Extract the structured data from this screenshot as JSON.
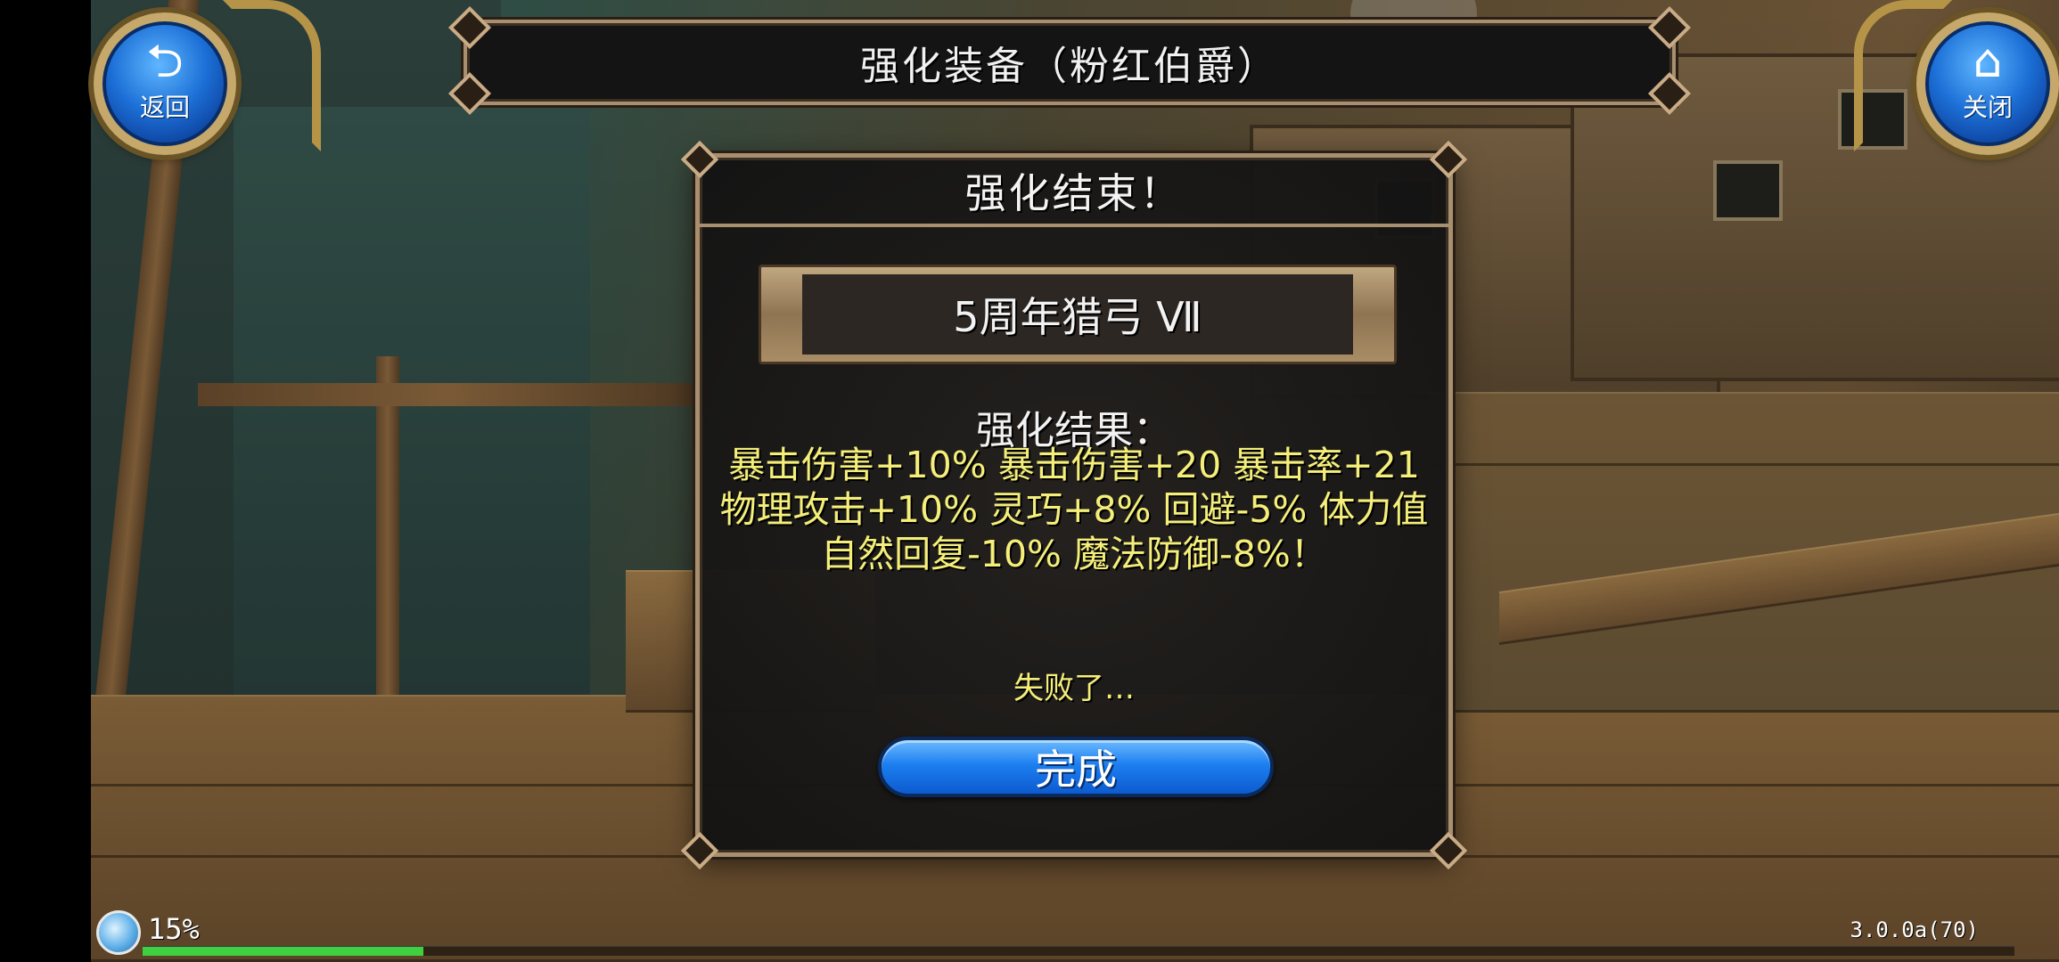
{
  "top_bar": {
    "title": "强化装备（粉红伯爵）"
  },
  "back_button": {
    "label": "返回",
    "icon": "back-arrow-icon"
  },
  "close_button": {
    "label": "关闭",
    "icon": "home-icon"
  },
  "dialog": {
    "title": "强化结束！",
    "item_name": "5周年猎弓 Ⅶ",
    "result_label": "强化结果：",
    "result_text": "暴击伤害+10% 暴击伤害+20 暴击率+21 物理攻击+10% 灵巧+8% 回避-5% 体力值自然回复-10% 魔法防御-8%！",
    "status": "失败了…",
    "done_label": "完成"
  },
  "footer": {
    "load_percent": "15%",
    "progress": 0.15,
    "version": "3.0.0a(70)"
  },
  "colors": {
    "result_text": "#f5ef7a",
    "button_blue": "#1d7ff0",
    "frame_gold": "#a88f70",
    "progress_green": "#3fd03f"
  }
}
